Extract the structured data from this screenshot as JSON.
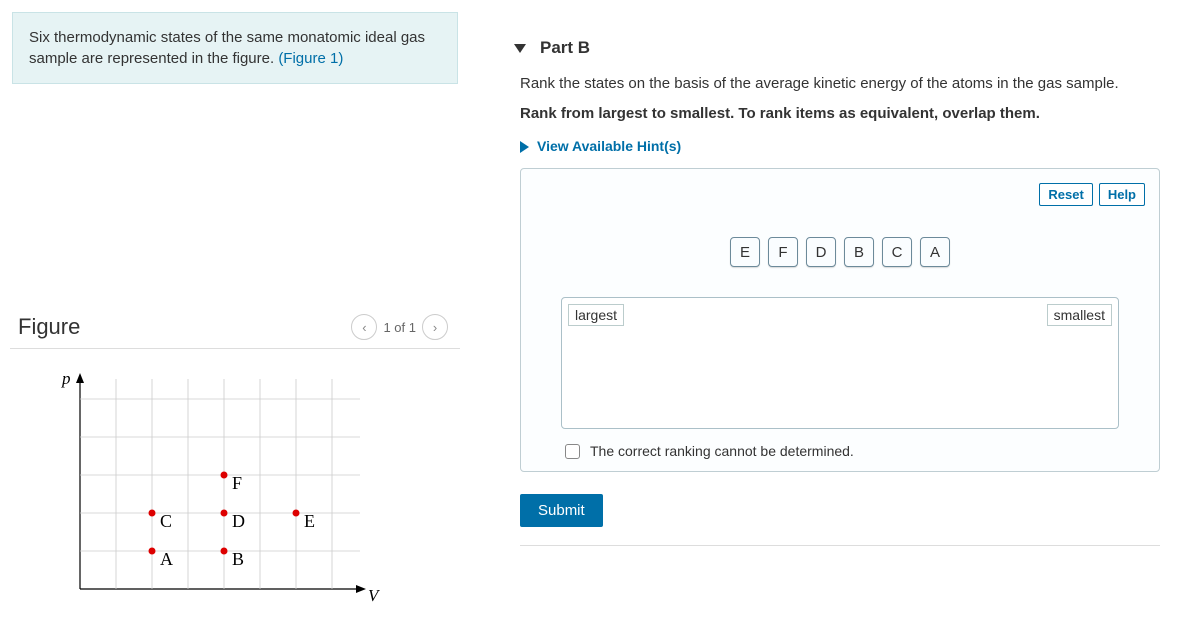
{
  "intro": {
    "text_before_link": "Six thermodynamic states of the same monatomic ideal gas sample are represented in the figure. ",
    "link_text": "(Figure 1)"
  },
  "figure": {
    "title": "Figure",
    "pager_label": "1 of 1",
    "y_axis": "p",
    "x_axis": "V",
    "points": [
      "A",
      "B",
      "C",
      "D",
      "E",
      "F"
    ]
  },
  "part": {
    "label": "Part B",
    "question": "Rank the states on the basis of the average kinetic energy of the atoms in the gas sample.",
    "instruction": "Rank from largest to smallest. To rank items as equivalent, overlap them.",
    "hints_link": "View Available Hint(s)",
    "reset": "Reset",
    "help": "Help",
    "items": [
      "E",
      "F",
      "D",
      "B",
      "C",
      "A"
    ],
    "zone_left": "largest",
    "zone_right": "smallest",
    "cannot_text": "The correct ranking cannot be determined.",
    "submit": "Submit"
  }
}
